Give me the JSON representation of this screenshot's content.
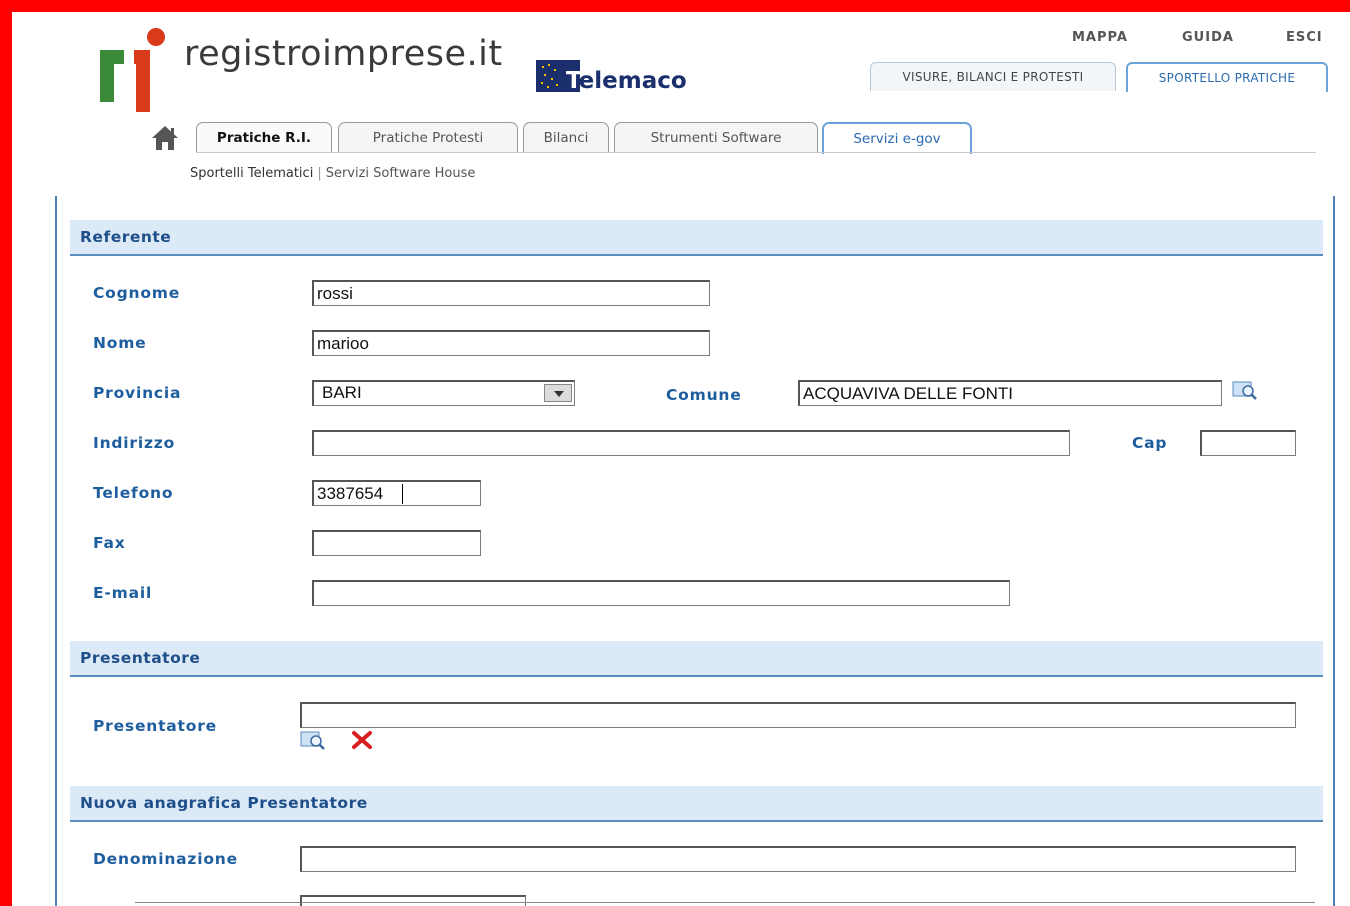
{
  "brand": {
    "site_name": "registroimprese.it",
    "partner_name": "elemaco",
    "partner_initial": "T"
  },
  "top_links": [
    "MAPPA",
    "GUIDA",
    "ESCI"
  ],
  "service_tabs": [
    {
      "label": "VISURE, BILANCI E PROTESTI",
      "active": false
    },
    {
      "label": "SPORTELLO PRATICHE",
      "active": true
    }
  ],
  "nav_tabs": [
    {
      "label": "Pratiche R.I.",
      "active": true
    },
    {
      "label": "Pratiche Protesti",
      "active": false
    },
    {
      "label": "Bilanci",
      "active": false
    },
    {
      "label": "Strumenti Software",
      "active": false
    },
    {
      "label": "Servizi e-gov",
      "active": false
    }
  ],
  "subnav": {
    "items": [
      "Sportelli Telematici",
      "Servizi Software House"
    ],
    "separator": "|"
  },
  "sections": {
    "referente": "Referente",
    "presentatore": "Presentatore",
    "nuova_anagrafica": "Nuova anagrafica Presentatore"
  },
  "referente": {
    "cognome": {
      "label": "Cognome",
      "value": "rossi"
    },
    "nome": {
      "label": "Nome",
      "value": "marioo"
    },
    "provincia": {
      "label": "Provincia",
      "value": "BARI"
    },
    "comune": {
      "label": "Comune",
      "value": "ACQUAVIVA DELLE FONTI"
    },
    "indirizzo": {
      "label": "Indirizzo",
      "value": ""
    },
    "cap": {
      "label": "Cap",
      "value": ""
    },
    "telefono": {
      "label": "Telefono",
      "value": "3387654"
    },
    "fax": {
      "label": "Fax",
      "value": ""
    },
    "email": {
      "label": "E-mail",
      "value": ""
    }
  },
  "presentatore": {
    "label": "Presentatore",
    "value": ""
  },
  "nuova_anagrafica": {
    "denominazione": {
      "label": "Denominazione",
      "value": ""
    }
  },
  "colors": {
    "frame": "#ff0000",
    "label_blue": "#1f5e9e",
    "section_bg": "#dce9f6",
    "section_border": "#5a8cc0"
  }
}
